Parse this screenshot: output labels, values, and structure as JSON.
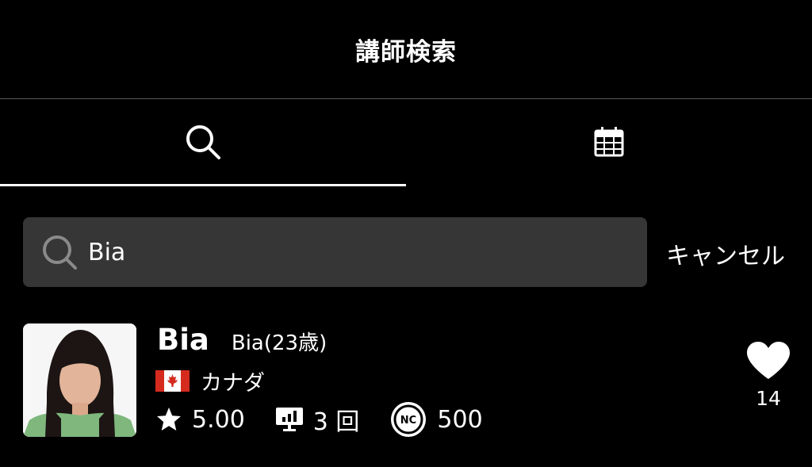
{
  "header": {
    "title": "講師検索"
  },
  "tabs": [
    {
      "icon": "search-icon",
      "active": true
    },
    {
      "icon": "calendar-icon",
      "active": false
    }
  ],
  "search": {
    "value": "Bia",
    "cancel_label": "キャンセル"
  },
  "result": {
    "name": "Bia",
    "sub_name": "Bia(23歳)",
    "country": "カナダ",
    "flag_icon": "canada-flag-icon",
    "rating": "5.00",
    "lessons": "3 回",
    "coin_label": "NC",
    "coins": "500",
    "favorites": "14"
  },
  "colors": {
    "background": "#000000",
    "search_box": "#363636",
    "divider": "#5a5a5a",
    "flag_red": "#d52b1e"
  }
}
